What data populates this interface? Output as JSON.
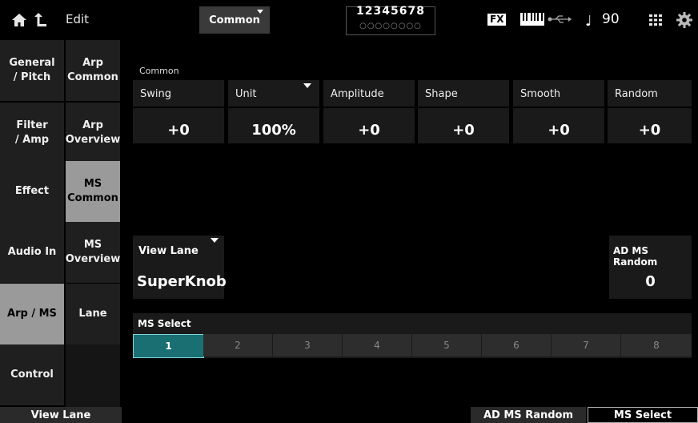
{
  "topbar": {
    "edit_label": "Edit",
    "part_select": "Common",
    "parts_numbers": "12345678",
    "parts_dots": "○○○○○○○○",
    "fx_label": "FX",
    "tempo_symbol": "♩",
    "tempo": "90"
  },
  "left_tabs": [
    {
      "label": "General\n/ Pitch",
      "active": false
    },
    {
      "label": "Filter\n/ Amp",
      "active": false
    },
    {
      "label": "Effect",
      "active": false
    },
    {
      "label": "Audio In",
      "active": false
    },
    {
      "label": "Arp / MS",
      "active": true
    },
    {
      "label": "Control",
      "active": false
    }
  ],
  "right_tabs": [
    {
      "label": "Arp\nCommon",
      "active": false
    },
    {
      "label": "Arp\nOverview",
      "active": false
    },
    {
      "label": "MS\nCommon",
      "active": true
    },
    {
      "label": "MS\nOverview",
      "active": false
    },
    {
      "label": "Lane",
      "active": false
    },
    {
      "label": "",
      "active": false
    }
  ],
  "common": {
    "section_label": "Common",
    "params": [
      {
        "label": "Swing",
        "value": "+0"
      },
      {
        "label": "Unit",
        "value": "100%"
      },
      {
        "label": "Amplitude",
        "value": "+0"
      },
      {
        "label": "Shape",
        "value": "+0"
      },
      {
        "label": "Smooth",
        "value": "+0"
      },
      {
        "label": "Random",
        "value": "+0"
      }
    ]
  },
  "view_lane": {
    "label": "View Lane",
    "value": "SuperKnob"
  },
  "ad_ms_random": {
    "label": "AD MS Random",
    "value": "0"
  },
  "ms_select": {
    "label": "MS Select",
    "options": [
      "1",
      "2",
      "3",
      "4",
      "5",
      "6",
      "7",
      "8"
    ],
    "selected": "1"
  },
  "bottom_bar": {
    "view_lane": "View Lane",
    "ad_ms_random": "AD MS Random",
    "ms_select": "MS Select"
  }
}
